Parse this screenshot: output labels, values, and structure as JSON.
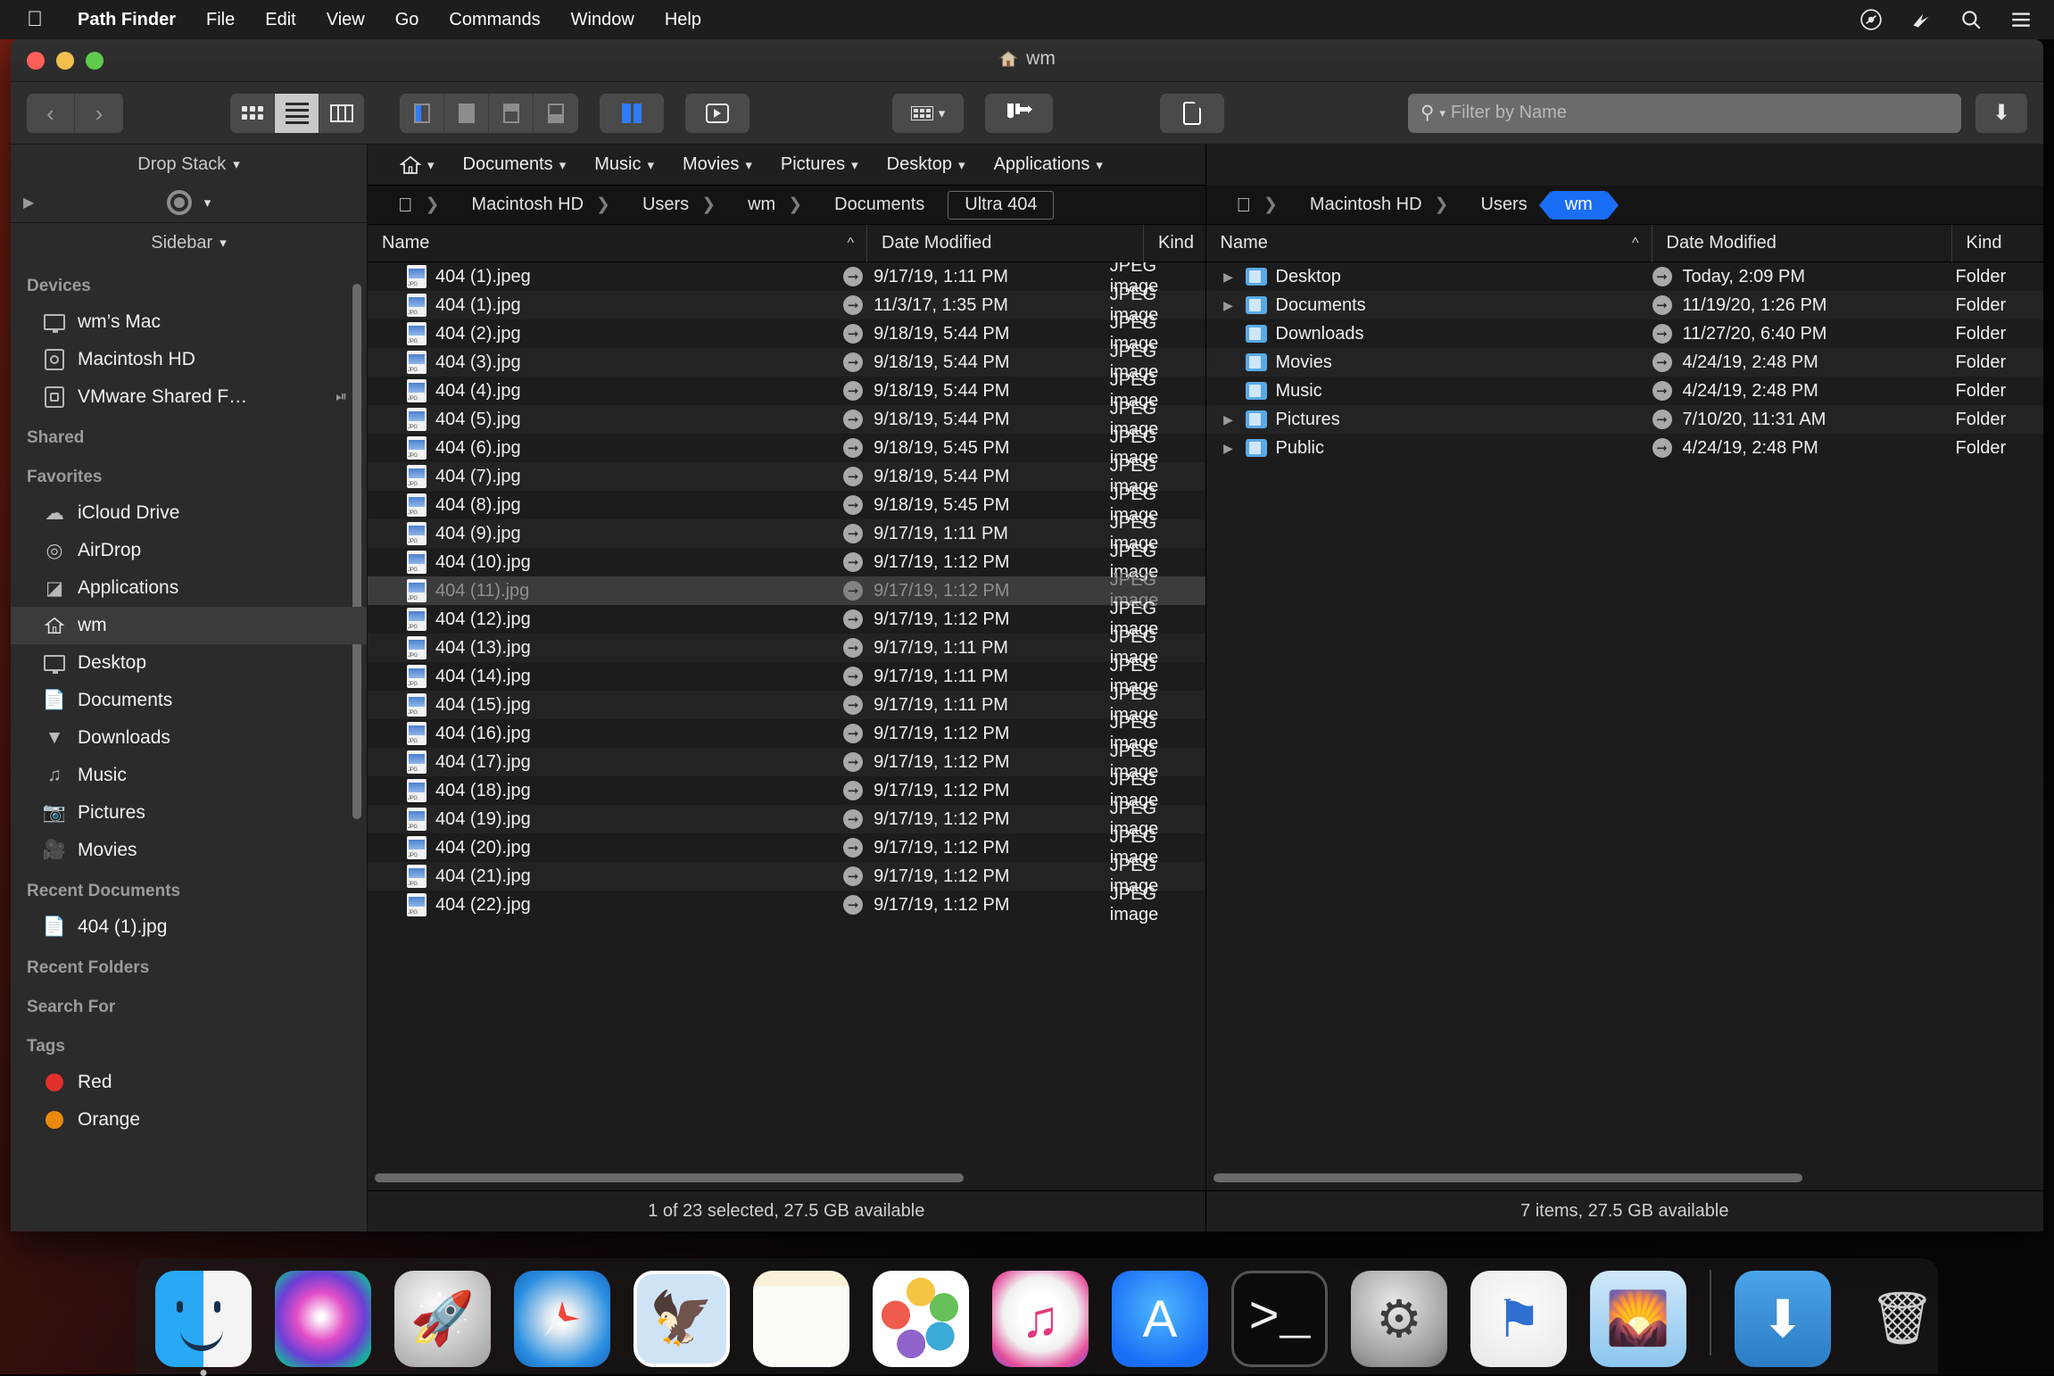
{
  "menubar": {
    "apple": "",
    "items": [
      "Path Finder",
      "File",
      "Edit",
      "View",
      "Go",
      "Commands",
      "Window",
      "Help"
    ],
    "right_icons": [
      "control-center-icon",
      "siri-icon",
      "spotlight-icon",
      "notification-center-icon"
    ]
  },
  "window": {
    "title": "wm",
    "title_icon": "home-icon"
  },
  "toolbar": {
    "back_label": "‹",
    "forward_label": "›",
    "view_modes": [
      "icon-view",
      "list-view",
      "column-view"
    ],
    "active_view": "list-view",
    "pane_layouts": [
      "single-left",
      "single",
      "horizontal-top",
      "horizontal-bottom"
    ],
    "dual_pane_label": "dual-pane",
    "preview_label": "preview",
    "arrange_label": "arrange-by",
    "caliper_label": "size-tool",
    "newdoc_label": "new-document",
    "search_placeholder": "Filter by Name",
    "search_value": "",
    "download_label": "⬇"
  },
  "sidebar": {
    "dropstack_header": "Drop Stack",
    "sidebar_header": "Sidebar",
    "groups": [
      {
        "label": "Devices",
        "items": [
          {
            "label": "wm’s Mac",
            "icon": "display-icon",
            "selected": false,
            "eject": false
          },
          {
            "label": "Macintosh HD",
            "icon": "harddisk-icon",
            "selected": false,
            "eject": false
          },
          {
            "label": "VMware Shared F…",
            "icon": "shared-disk-icon",
            "selected": false,
            "eject": true
          }
        ]
      },
      {
        "label": "Shared",
        "items": []
      },
      {
        "label": "Favorites",
        "items": [
          {
            "label": "iCloud Drive",
            "icon": "cloud-icon",
            "selected": false,
            "eject": false
          },
          {
            "label": "AirDrop",
            "icon": "airdrop-icon",
            "selected": false,
            "eject": false
          },
          {
            "label": "Applications",
            "icon": "applications-icon",
            "selected": false,
            "eject": false
          },
          {
            "label": "wm",
            "icon": "home-icon",
            "selected": true,
            "eject": false
          },
          {
            "label": "Desktop",
            "icon": "desktop-icon",
            "selected": false,
            "eject": false
          },
          {
            "label": "Documents",
            "icon": "documents-icon",
            "selected": false,
            "eject": false
          },
          {
            "label": "Downloads",
            "icon": "downloads-icon",
            "selected": false,
            "eject": false
          },
          {
            "label": "Music",
            "icon": "music-icon",
            "selected": false,
            "eject": false
          },
          {
            "label": "Pictures",
            "icon": "pictures-icon",
            "selected": false,
            "eject": false
          },
          {
            "label": "Movies",
            "icon": "movies-icon",
            "selected": false,
            "eject": false
          }
        ]
      },
      {
        "label": "Recent Documents",
        "items": [
          {
            "label": "404 (1).jpg",
            "icon": "document-icon",
            "selected": false,
            "eject": false
          }
        ]
      },
      {
        "label": "Recent Folders",
        "items": []
      },
      {
        "label": "Search For",
        "items": []
      },
      {
        "label": "Tags",
        "items": [
          {
            "label": "Red",
            "icon": "tag-dot-icon",
            "color": "#e0302c",
            "selected": false,
            "eject": false
          },
          {
            "label": "Orange",
            "icon": "tag-dot-icon",
            "color": "#e98a0b",
            "selected": false,
            "eject": false
          }
        ]
      }
    ]
  },
  "shortcut_bar": {
    "home_icon": "home-icon",
    "items": [
      "Documents",
      "Music",
      "Movies",
      "Pictures",
      "Desktop",
      "Applications"
    ]
  },
  "left_pane": {
    "breadcrumb": [
      "Macintosh HD",
      "Users",
      "wm",
      "Documents",
      "Ultra 404"
    ],
    "breadcrumb_current": "Ultra 404",
    "columns": [
      "Name",
      "Date Modified",
      "Kind"
    ],
    "sort_column": "Name",
    "sort_direction": "ascending",
    "rows": [
      {
        "name": "404 (1).jpeg",
        "date": "9/17/19, 1:11 PM",
        "kind": "JPEG image",
        "selected": false
      },
      {
        "name": "404 (1).jpg",
        "date": "11/3/17, 1:35 PM",
        "kind": "JPEG image",
        "selected": false
      },
      {
        "name": "404 (2).jpg",
        "date": "9/18/19, 5:44 PM",
        "kind": "JPEG image",
        "selected": false
      },
      {
        "name": "404 (3).jpg",
        "date": "9/18/19, 5:44 PM",
        "kind": "JPEG image",
        "selected": false
      },
      {
        "name": "404 (4).jpg",
        "date": "9/18/19, 5:44 PM",
        "kind": "JPEG image",
        "selected": false
      },
      {
        "name": "404 (5).jpg",
        "date": "9/18/19, 5:44 PM",
        "kind": "JPEG image",
        "selected": false
      },
      {
        "name": "404 (6).jpg",
        "date": "9/18/19, 5:45 PM",
        "kind": "JPEG image",
        "selected": false
      },
      {
        "name": "404 (7).jpg",
        "date": "9/18/19, 5:44 PM",
        "kind": "JPEG image",
        "selected": false
      },
      {
        "name": "404 (8).jpg",
        "date": "9/18/19, 5:45 PM",
        "kind": "JPEG image",
        "selected": false
      },
      {
        "name": "404 (9).jpg",
        "date": "9/17/19, 1:11 PM",
        "kind": "JPEG image",
        "selected": false
      },
      {
        "name": "404 (10).jpg",
        "date": "9/17/19, 1:12 PM",
        "kind": "JPEG image",
        "selected": false
      },
      {
        "name": "404 (11).jpg",
        "date": "9/17/19, 1:12 PM",
        "kind": "JPEG image",
        "selected": true
      },
      {
        "name": "404 (12).jpg",
        "date": "9/17/19, 1:12 PM",
        "kind": "JPEG image",
        "selected": false
      },
      {
        "name": "404 (13).jpg",
        "date": "9/17/19, 1:11 PM",
        "kind": "JPEG image",
        "selected": false
      },
      {
        "name": "404 (14).jpg",
        "date": "9/17/19, 1:11 PM",
        "kind": "JPEG image",
        "selected": false
      },
      {
        "name": "404 (15).jpg",
        "date": "9/17/19, 1:11 PM",
        "kind": "JPEG image",
        "selected": false
      },
      {
        "name": "404 (16).jpg",
        "date": "9/17/19, 1:12 PM",
        "kind": "JPEG image",
        "selected": false
      },
      {
        "name": "404 (17).jpg",
        "date": "9/17/19, 1:12 PM",
        "kind": "JPEG image",
        "selected": false
      },
      {
        "name": "404 (18).jpg",
        "date": "9/17/19, 1:12 PM",
        "kind": "JPEG image",
        "selected": false
      },
      {
        "name": "404 (19).jpg",
        "date": "9/17/19, 1:12 PM",
        "kind": "JPEG image",
        "selected": false
      },
      {
        "name": "404 (20).jpg",
        "date": "9/17/19, 1:12 PM",
        "kind": "JPEG image",
        "selected": false
      },
      {
        "name": "404 (21).jpg",
        "date": "9/17/19, 1:12 PM",
        "kind": "JPEG image",
        "selected": false
      },
      {
        "name": "404 (22).jpg",
        "date": "9/17/19, 1:12 PM",
        "kind": "JPEG image",
        "selected": false
      }
    ],
    "status": "1 of 23 selected, 27.5 GB available"
  },
  "right_pane": {
    "breadcrumb": [
      "Macintosh HD",
      "Users",
      "wm"
    ],
    "breadcrumb_current": "wm",
    "columns": [
      "Name",
      "Date Modified",
      "Kind"
    ],
    "sort_column": "Name",
    "sort_direction": "ascending",
    "rows": [
      {
        "name": "Desktop",
        "date": "Today, 2:09 PM",
        "kind": "Folder",
        "expandable": true
      },
      {
        "name": "Documents",
        "date": "11/19/20, 1:26 PM",
        "kind": "Folder",
        "expandable": true
      },
      {
        "name": "Downloads",
        "date": "11/27/20, 6:40 PM",
        "kind": "Folder",
        "expandable": false
      },
      {
        "name": "Movies",
        "date": "4/24/19, 2:48 PM",
        "kind": "Folder",
        "expandable": false
      },
      {
        "name": "Music",
        "date": "4/24/19, 2:48 PM",
        "kind": "Folder",
        "expandable": false
      },
      {
        "name": "Pictures",
        "date": "7/10/20, 11:31 AM",
        "kind": "Folder",
        "expandable": true
      },
      {
        "name": "Public",
        "date": "4/24/19, 2:48 PM",
        "kind": "Folder",
        "expandable": true
      }
    ],
    "status": "7 items, 27.5 GB available"
  },
  "dock": {
    "items": [
      {
        "name": "finder",
        "label": "Finder",
        "running": true
      },
      {
        "name": "siri",
        "label": "Siri",
        "running": false
      },
      {
        "name": "launchpad",
        "label": "Launchpad",
        "running": false
      },
      {
        "name": "safari",
        "label": "Safari",
        "running": false
      },
      {
        "name": "mail",
        "label": "Mail",
        "running": false
      },
      {
        "name": "notes",
        "label": "Notes",
        "running": false
      },
      {
        "name": "photos",
        "label": "Photos",
        "running": false
      },
      {
        "name": "itunes",
        "label": "iTunes",
        "running": false
      },
      {
        "name": "appstore",
        "label": "App Store",
        "running": false
      },
      {
        "name": "terminal",
        "label": "Terminal",
        "running": false
      },
      {
        "name": "system-preferences",
        "label": "System Preferences",
        "running": false
      },
      {
        "name": "maps",
        "label": "Maps",
        "running": false
      },
      {
        "name": "preview",
        "label": "Preview",
        "running": false
      },
      {
        "name": "downloads-folder",
        "label": "Downloads",
        "running": false
      },
      {
        "name": "trash",
        "label": "Trash",
        "running": false
      }
    ]
  },
  "colors": {
    "accent": "#1a6ef5",
    "window_bg": "#262626",
    "pane_bg": "#1c1c1c",
    "selection": "#3c3c3c"
  }
}
